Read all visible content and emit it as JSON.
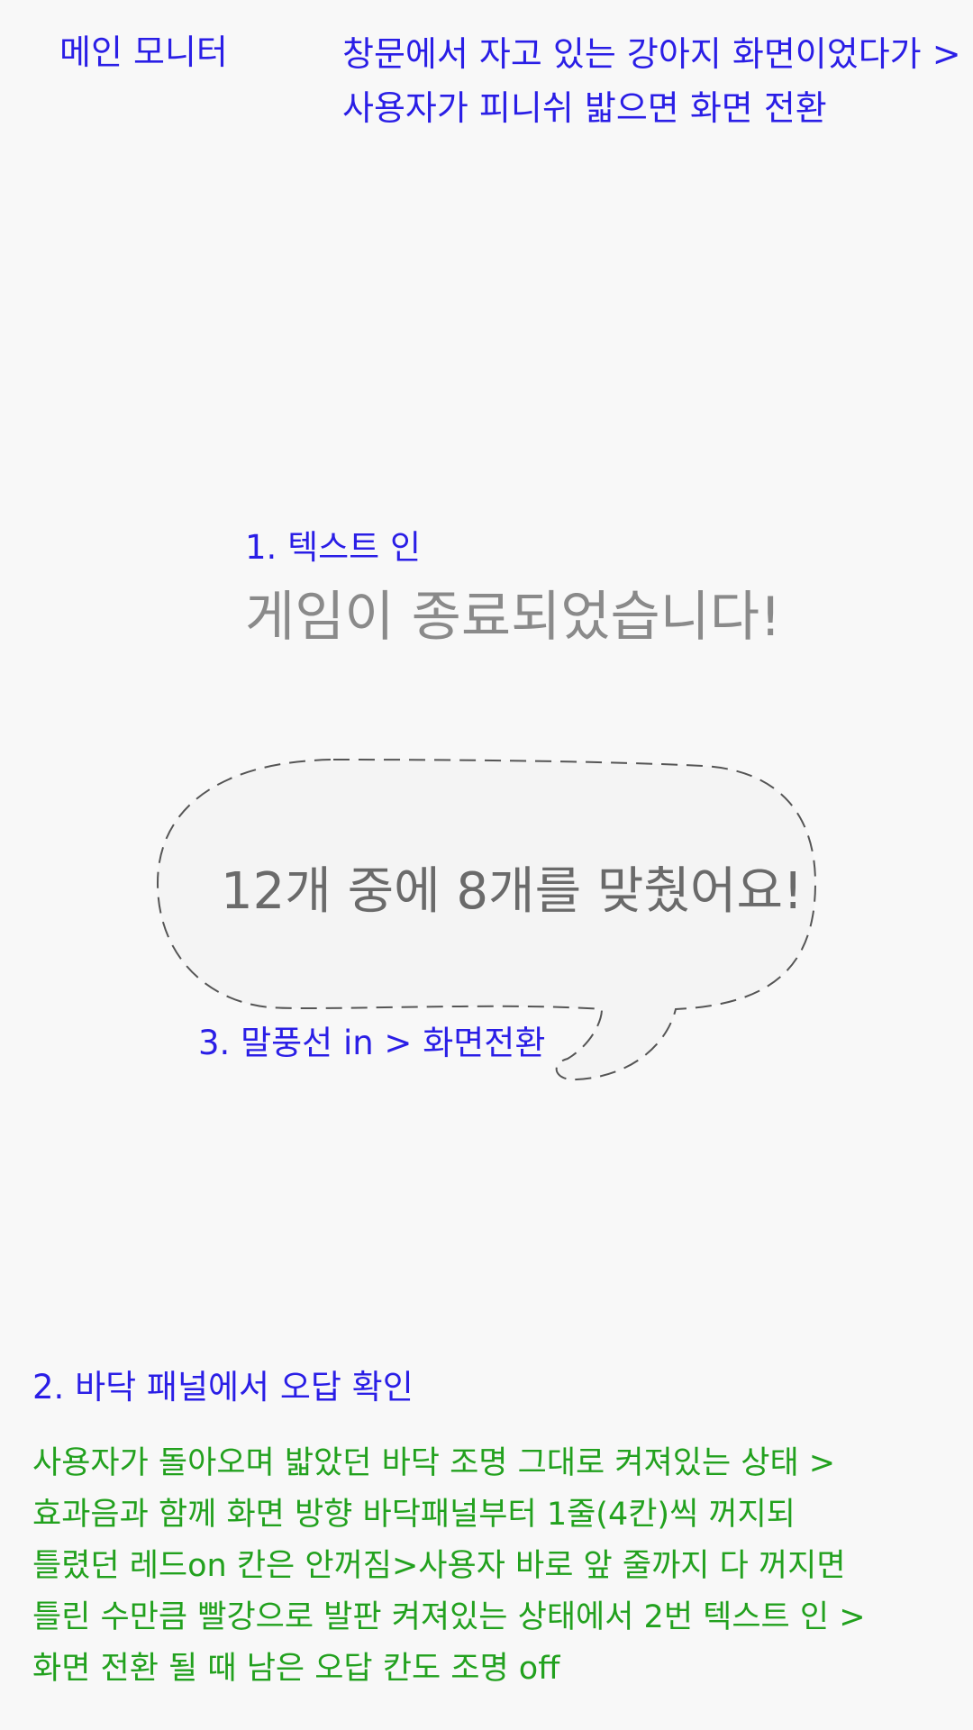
{
  "main_monitor_label": "메인 모니터",
  "top_note": {
    "line1": "창문에서 자고 있는 강아지 화면이었다가 >",
    "line2": "사용자가 피니쉬 밟으면 화면 전환"
  },
  "step1_label": "1. 텍스트 인",
  "game_over_text": "게임이 종료되었습니다!",
  "bubble_text": "12개 중에 8개를 맞췄어요!",
  "step3_label": "3. 말풍선 in > 화면전환",
  "step2_label": "2. 바닥 패널에서 오답 확인",
  "green_notes": [
    "사용자가 돌아오며 밟았던 바닥 조명 그대로 켜져있는 상태 >",
    "효과음과 함께 화면 방향 바닥패널부터 1줄(4칸)씩 꺼지되",
    "틀렸던 레드on 칸은 안꺼짐>사용자 바로 앞 줄까지 다 꺼지면",
    "틀린 수만큼 빨강으로 발판 켜져있는 상태에서 2번 텍스트 인 >",
    " 화면 전환 될 때 남은 오답 칸도 조명 off"
  ],
  "colors": {
    "annotation_blue": "#2a1ee6",
    "annotation_green": "#22a11e",
    "title_gray": "#8a8a8a",
    "bubble_fill": "#f4f4f4"
  }
}
